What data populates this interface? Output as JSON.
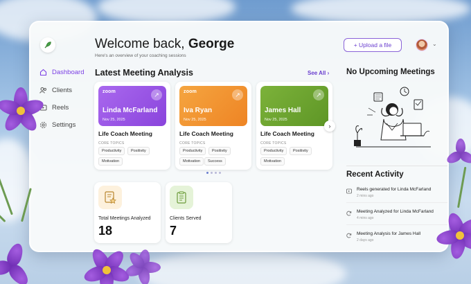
{
  "sidebar": {
    "items": [
      {
        "label": "Dashboard",
        "icon": "home-icon",
        "active": true
      },
      {
        "label": "Clients",
        "icon": "users-icon",
        "active": false
      },
      {
        "label": "Reels",
        "icon": "video-icon",
        "active": false
      },
      {
        "label": "Settings",
        "icon": "gear-icon",
        "active": false
      }
    ]
  },
  "header": {
    "welcome_prefix": "Welcome back, ",
    "user_name": "George",
    "subtitle": "Here's an overview of your coaching sessions",
    "upload_label": "+ Upload a file"
  },
  "meetings": {
    "section_title": "Latest Meeting Analysis",
    "see_all": "See All",
    "core_topics_label": "CORE TOPICS",
    "cards": [
      {
        "platform": "zoom",
        "client": "Linda McFarland",
        "date": "Nov 25, 2025",
        "title": "Life Coach Meeting",
        "color": "#9b59e6",
        "tags": [
          "Productivity",
          "Positivity",
          "Motivation"
        ]
      },
      {
        "platform": "zoom",
        "client": "Iva Ryan",
        "date": "Nov 25, 2025",
        "title": "Life Coach Meeting",
        "color": "#f0962e",
        "tags": [
          "Productivity",
          "Positivity",
          "Motivation",
          "Success"
        ]
      },
      {
        "platform": "",
        "client": "James Hall",
        "date": "Nov 25, 2025",
        "title": "Life Coach Meeting",
        "color": "#6fa52e",
        "tags": [
          "Productivity",
          "Positivity",
          "Motivation"
        ]
      }
    ]
  },
  "stats": [
    {
      "label": "Total Meetings Analyzed",
      "value": "18",
      "icon": "document-star-icon",
      "bg": "#fdf1dd"
    },
    {
      "label": "Clients Served",
      "value": "7",
      "icon": "clipboard-list-icon",
      "bg": "#e5f3d8"
    }
  ],
  "upcoming": {
    "title": "No Upcoming Meetings"
  },
  "recent": {
    "title": "Recent Activity",
    "items": [
      {
        "text": "Reels generated for Linda McFarland",
        "time": "2 mins ago",
        "icon": "reel-icon"
      },
      {
        "text": "Meeting Analyzed for Linda McFarland",
        "time": "4 mins ago",
        "icon": "refresh-icon"
      },
      {
        "text": "Meeting Analysis for James Hall",
        "time": "2 days ago",
        "icon": "refresh-icon"
      }
    ]
  },
  "colors": {
    "accent": "#7b3fe4"
  }
}
